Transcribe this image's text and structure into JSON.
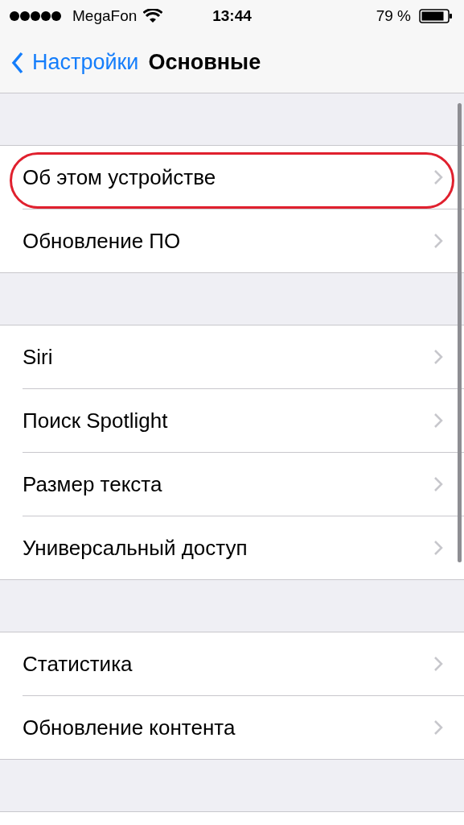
{
  "status_bar": {
    "carrier": "MegaFon",
    "time": "13:44",
    "battery": "79 %"
  },
  "nav_bar": {
    "back": "Настройки",
    "title": "Основные"
  },
  "groups": [
    {
      "items": [
        {
          "label": "Об этом устройстве",
          "highlighted": true
        },
        {
          "label": "Обновление ПО",
          "highlighted": false
        }
      ]
    },
    {
      "items": [
        {
          "label": "Siri",
          "highlighted": false
        },
        {
          "label": "Поиск Spotlight",
          "highlighted": false
        },
        {
          "label": "Размер текста",
          "highlighted": false
        },
        {
          "label": "Универсальный доступ",
          "highlighted": false
        }
      ]
    },
    {
      "items": [
        {
          "label": "Статистика",
          "highlighted": false
        },
        {
          "label": "Обновление контента",
          "highlighted": false
        }
      ]
    }
  ]
}
